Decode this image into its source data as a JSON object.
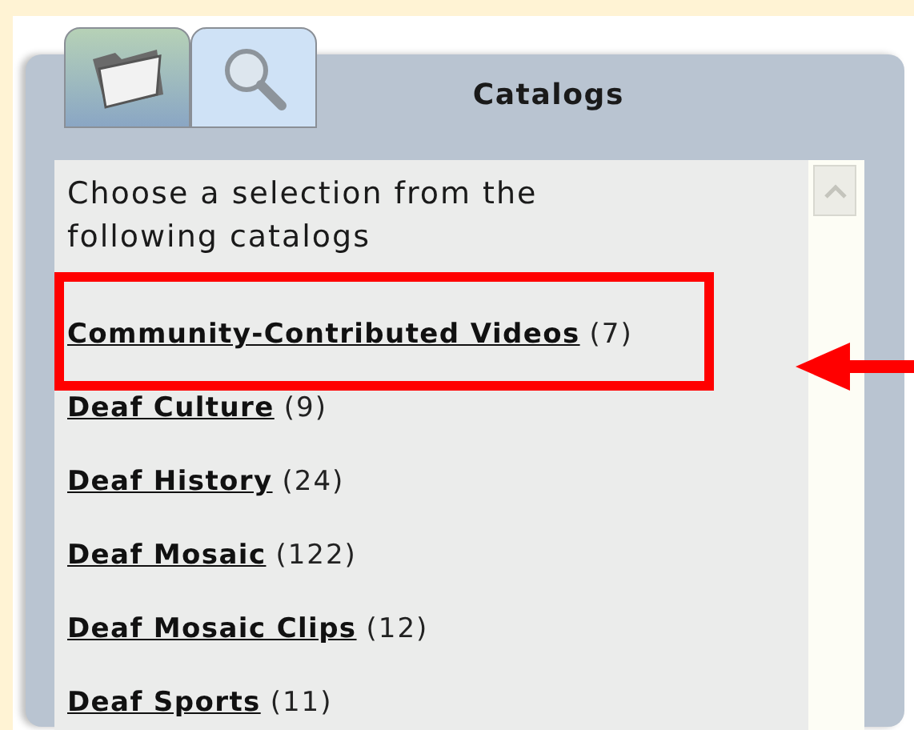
{
  "tabs": [
    {
      "kind": "folder",
      "selected": true
    },
    {
      "kind": "search",
      "selected": false
    }
  ],
  "panel": {
    "title": "Catalogs"
  },
  "intro": "Choose a selection from the following catalogs",
  "catalogs": [
    {
      "name": "Community-Contributed Videos",
      "count": "(7)",
      "highlighted": true
    },
    {
      "name": "Deaf Culture",
      "count": "(9)",
      "highlighted": false
    },
    {
      "name": "Deaf History",
      "count": "(24)",
      "highlighted": false
    },
    {
      "name": "Deaf Mosaic",
      "count": "(122)",
      "highlighted": false
    },
    {
      "name": "Deaf Mosaic Clips",
      "count": "(12)",
      "highlighted": false
    },
    {
      "name": "Deaf Sports",
      "count": "(11)",
      "highlighted": false
    }
  ]
}
